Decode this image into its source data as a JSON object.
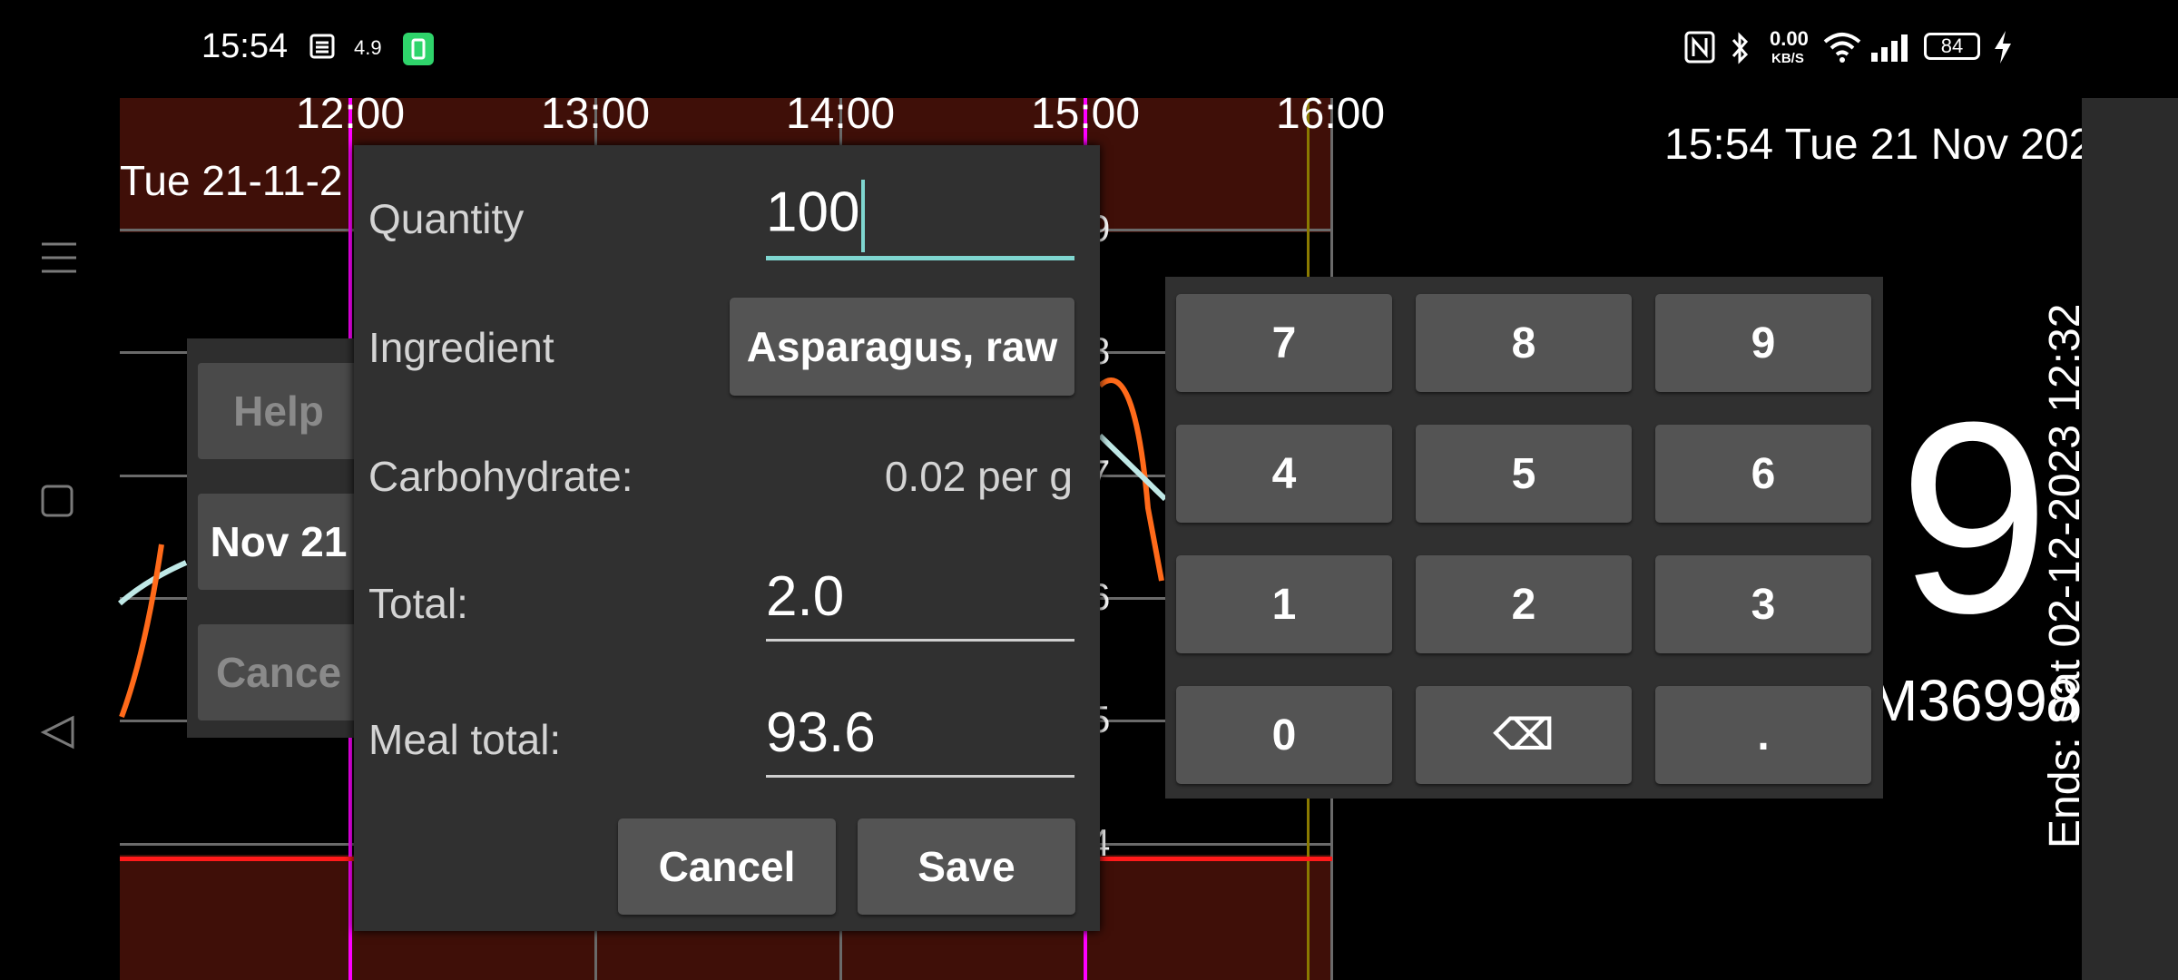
{
  "status_bar": {
    "time": "15:54",
    "speed_value": "4.9",
    "net_speed": "0.00",
    "net_unit": "KB/S",
    "battery": "84"
  },
  "chart": {
    "time_ticks": [
      "12:00",
      "13:00",
      "14:00",
      "15:00",
      "16:00"
    ],
    "date_label": "Tue 21-11-2",
    "y_labels": [
      "9",
      "8",
      "7",
      "6",
      "5",
      "4"
    ]
  },
  "header_right": {
    "datetime": "15:54 Tue 21 Nov 202",
    "big_value": "9",
    "sensor_id": "M36998",
    "ends_text": "Ends: Sat 02-12-2023 12:32"
  },
  "background_dialog": {
    "help_label": "Help",
    "date_label": "Nov 21",
    "cancel_label": "Cance"
  },
  "dialog": {
    "quantity_label": "Quantity",
    "quantity_value": "100",
    "ingredient_label": "Ingredient",
    "ingredient_value": "Asparagus, raw",
    "carb_label": "Carbohydrate:",
    "carb_value": "0.02 per g",
    "total_label": "Total:",
    "total_value": "2.0",
    "meal_total_label": "Meal total:",
    "meal_total_value": "93.6",
    "cancel_label": "Cancel",
    "save_label": "Save"
  },
  "keypad": {
    "rows": [
      [
        "7",
        "8",
        "9"
      ],
      [
        "4",
        "5",
        "6"
      ],
      [
        "1",
        "2",
        "3"
      ],
      [
        "0",
        "⌫",
        "."
      ]
    ]
  },
  "colors": {
    "background": "#000000",
    "band": "#3f0f08",
    "now_marker": "#ff00ff",
    "low_line": "#ff1a1a",
    "glucose_line": "#ff6a1a",
    "trend_line": "#bfe8e6",
    "accent_cursor": "#7fd6d0"
  }
}
